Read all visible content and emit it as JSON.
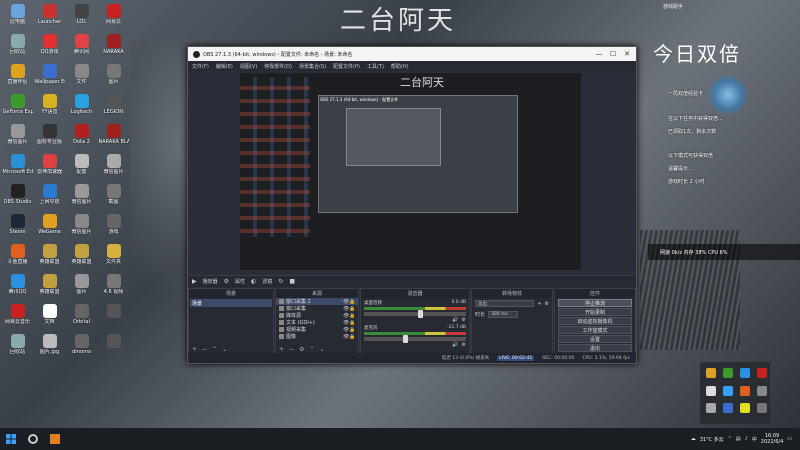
{
  "desktop": {
    "background_title": "二台阿天",
    "icons": [
      {
        "label": "此电脑",
        "icon": "computer-icon",
        "color": "#6aa4e0"
      },
      {
        "label": "Launcher",
        "icon": "launcher-icon",
        "color": "#c93030"
      },
      {
        "label": "LOL",
        "icon": "game-icon",
        "color": "#444"
      },
      {
        "label": "网易云",
        "icon": "music-icon",
        "color": "#c92020"
      },
      {
        "label": "回收站",
        "icon": "recycle-bin-icon",
        "color": "#8aa"
      },
      {
        "label": "QQ游戏",
        "icon": "qq-game-icon",
        "color": "#e03030"
      },
      {
        "label": "腾讯网",
        "icon": "browser-icon",
        "color": "#dd4444"
      },
      {
        "label": "NARAKA",
        "icon": "naraka-icon",
        "color": "#a02020"
      },
      {
        "label": "直播伴侣",
        "icon": "live-icon",
        "color": "#e0a020"
      },
      {
        "label": "Wallpaper Engine",
        "icon": "wallpaper-icon",
        "color": "#3a6fd0"
      },
      {
        "label": "文件",
        "icon": "file-icon",
        "color": "#888"
      },
      {
        "label": "图片",
        "icon": "image-icon",
        "color": "#777"
      },
      {
        "label": "GeForce Experience",
        "icon": "nvidia-icon",
        "color": "#3a9a2a"
      },
      {
        "label": "YY语音",
        "icon": "yy-icon",
        "color": "#d8b020"
      },
      {
        "label": "Logitech",
        "icon": "logitech-icon",
        "color": "#2aa0e0"
      },
      {
        "label": "LEGION",
        "icon": "legion-icon",
        "color": "#555"
      },
      {
        "label": "微信图片",
        "icon": "image-icon",
        "color": "#999"
      },
      {
        "label": "图标专业版",
        "icon": "app-icon",
        "color": "#333"
      },
      {
        "label": "Dota 2",
        "icon": "dota-icon",
        "color": "#b02020"
      },
      {
        "label": "NARAKA BLADEPOINT",
        "icon": "naraka-icon",
        "color": "#a02020"
      },
      {
        "label": "Microsoft Edge",
        "icon": "edge-icon",
        "color": "#2a90d8"
      },
      {
        "label": "雷神加速器",
        "icon": "accelerator-icon",
        "color": "#e04040"
      },
      {
        "label": "配置",
        "icon": "image-icon",
        "color": "#bbb"
      },
      {
        "label": "微信图片",
        "icon": "image-icon",
        "color": "#aaa"
      },
      {
        "label": "OBS Studio",
        "icon": "obs-icon",
        "color": "#222"
      },
      {
        "label": "上网导航",
        "icon": "browser-icon",
        "color": "#2a7ad0"
      },
      {
        "label": "微信图片",
        "icon": "image-icon",
        "color": "#999"
      },
      {
        "label": "截图",
        "icon": "image-icon",
        "color": "#777"
      },
      {
        "label": "Steam",
        "icon": "steam-icon",
        "color": "#1b2838"
      },
      {
        "label": "WeGame",
        "icon": "wegame-icon",
        "color": "#e0a020"
      },
      {
        "label": "微信图片",
        "icon": "image-icon",
        "color": "#888"
      },
      {
        "label": "游戏",
        "icon": "image-icon",
        "color": "#666"
      },
      {
        "label": "斗鱼直播",
        "icon": "douyu-icon",
        "color": "#e06020"
      },
      {
        "label": "英雄联盟",
        "icon": "lol-icon",
        "color": "#c0a040"
      },
      {
        "label": "英雄联盟",
        "icon": "lol-icon",
        "color": "#c0a040"
      },
      {
        "label": "文件夹",
        "icon": "folder-icon",
        "color": "#d8b040"
      },
      {
        "label": "腾讯QQ",
        "icon": "qq-icon",
        "color": "#2a90e0"
      },
      {
        "label": "英雄联盟",
        "icon": "lol-icon",
        "color": "#c0a040"
      },
      {
        "label": "图片",
        "icon": "image-icon",
        "color": "#999"
      },
      {
        "label": "4.6 视频",
        "icon": "video-icon",
        "color": "#777"
      },
      {
        "label": "网易云音乐",
        "icon": "music-icon",
        "color": "#c92020"
      },
      {
        "label": "文档",
        "icon": "doc-icon",
        "color": "#fff"
      },
      {
        "label": "Orbital",
        "icon": "app-icon",
        "color": "#666"
      },
      {
        "label": "",
        "icon": "image-icon",
        "color": "#555"
      },
      {
        "label": "回收站",
        "icon": "recycle-bin-icon",
        "color": "#8aa"
      },
      {
        "label": "图片.jpg",
        "icon": "image-icon",
        "color": "#bbb"
      },
      {
        "label": "dmomo",
        "icon": "image-icon",
        "color": "#666"
      },
      {
        "label": "",
        "icon": "image-icon",
        "color": "#555"
      }
    ]
  },
  "widget": {
    "title": "游戏助手",
    "date": "今日双倍",
    "items": [
      "一局双倍经验卡",
      "在以下任务中获得双倍...",
      "已领取1次，剩余次数",
      "以下模式可获得双倍",
      "温馨提示...",
      "游戏时长 2 小时",
      "领取奖励"
    ],
    "sysbar": "网速 0k/s 内存 38% CPU 6%"
  },
  "obs": {
    "title": "OBS 27.1.3 (64-bit, windows) - 配置文件: 未命名 - 场景: 未命名",
    "menu": [
      "文件(F)",
      "编辑(E)",
      "视图(V)",
      "停靠部件(D)",
      "场景集合(S)",
      "配置文件(P)",
      "工具(T)",
      "帮助(H)"
    ],
    "preview_title": "二台阿天",
    "preview_inner_title": "OBS 27.1.3 (64-bit, windows) - 配置文件",
    "controls_bar": {
      "label": "播放器",
      "props": "属性",
      "filters": "滤镜"
    },
    "docks": {
      "scenes": "场景",
      "sources": "来源",
      "mixer": "混音器",
      "transitions": "转场特效",
      "controls": "控件"
    },
    "scenes": [
      "场景"
    ],
    "sources": [
      {
        "name": "窗口采集 2",
        "type": "window"
      },
      {
        "name": "窗口采集",
        "type": "window"
      },
      {
        "name": "媒体源",
        "type": "media"
      },
      {
        "name": "文本 (GDI+)",
        "type": "text"
      },
      {
        "name": "视频采集",
        "type": "video"
      },
      {
        "name": "图像",
        "type": "image"
      }
    ],
    "mixer": [
      {
        "name": "桌面音频",
        "db": "0.0 dB",
        "level": 0.55
      },
      {
        "name": "麦克风",
        "db": "-21.7 dB",
        "level": 0.4
      }
    ],
    "transition": {
      "name": "淡出",
      "duration_label": "时长",
      "duration": "300 ms"
    },
    "control_buttons": [
      "停止推流",
      "开始录制",
      "启动虚拟摄像机",
      "工作室模式",
      "设置",
      "退出"
    ],
    "status": {
      "live": "LIVE: 00:02:45",
      "rec": "REC: 00:00:00",
      "cpu": "CPU: 3.1%, 59.94 fps",
      "kb": "延迟 13 (0.0%) 帧丢失"
    }
  },
  "taskbar": {
    "time": "16:09",
    "date": "2022/6/4",
    "weather": "31°C 多云",
    "ime": "中"
  }
}
